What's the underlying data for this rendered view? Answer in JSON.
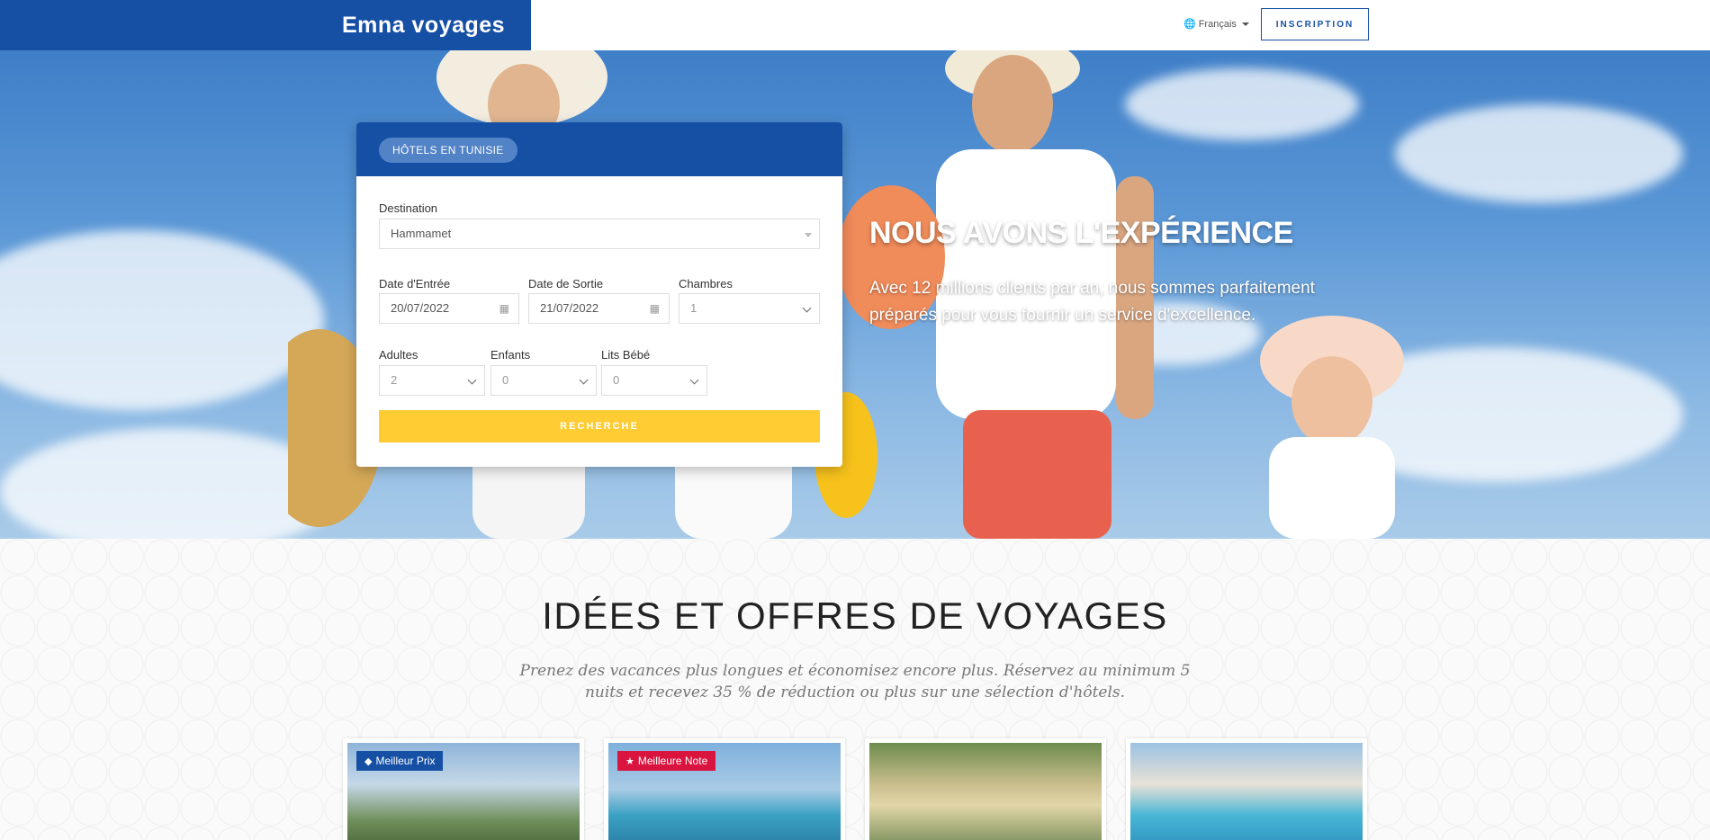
{
  "header": {
    "brand": "Emna voyages",
    "language": "Français",
    "signup_label": "INSCRIPTION"
  },
  "hero": {
    "title": "NOUS AVONS L'EXPÉRIENCE",
    "text": "Avec 12 millions clients par an, nous sommes parfaitement préparés pour vous fournir un service d'excellence."
  },
  "search": {
    "tab_label": "HÔTELS EN TUNISIE",
    "destination_label": "Destination",
    "destination_value": "Hammamet",
    "checkin_label": "Date d'Entrée",
    "checkin_value": "20/07/2022",
    "checkout_label": "Date de Sortie",
    "checkout_value": "21/07/2022",
    "rooms_label": "Chambres",
    "rooms_value": "1",
    "adults_label": "Adultes",
    "adults_value": "2",
    "children_label": "Enfants",
    "children_value": "0",
    "cribs_label": "Lits Bébé",
    "cribs_value": "0",
    "button_label": "RECHERCHE"
  },
  "offers": {
    "title": "IDÉES ET OFFRES DE VOYAGES",
    "subtitle": "Prenez des vacances plus longues et économisez encore plus. Réservez au minimum 5 nuits et recevez 35 % de réduction ou plus sur une sélection d'hôtels.",
    "cards": [
      {
        "badge": "Meilleur Prix",
        "badge_color": "#1650a5",
        "badge_icon": "tag-icon"
      },
      {
        "badge": "Meilleure Note",
        "badge_color": "#d9143f",
        "badge_icon": "trophy-icon"
      },
      {
        "badge": "",
        "badge_color": "",
        "badge_icon": ""
      },
      {
        "badge": "",
        "badge_color": "",
        "badge_icon": ""
      }
    ]
  },
  "colors": {
    "primary": "#1650a5",
    "accent": "#ffcc33",
    "badge_red": "#d9143f"
  }
}
